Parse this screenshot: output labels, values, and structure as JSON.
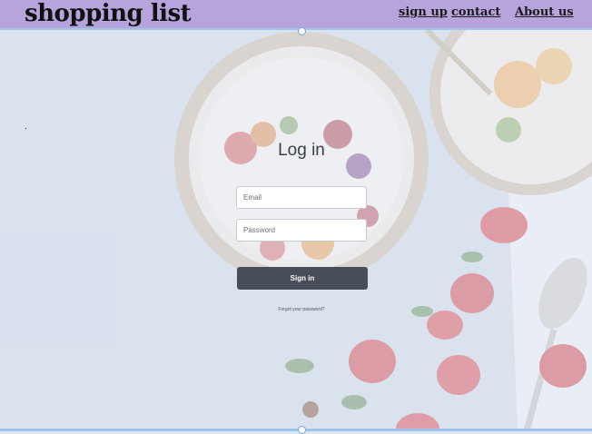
{
  "header": {
    "brand": "shopping list",
    "nav": [
      {
        "label": "sign up"
      },
      {
        "label": "contact"
      },
      {
        "label": "About us"
      }
    ]
  },
  "login": {
    "title": "Log in",
    "email_placeholder": "Email",
    "password_placeholder": "Password",
    "submit_label": "Sign in",
    "forgot_label": "Forgot your password?"
  },
  "colors": {
    "header_bg": "#b8a4dc",
    "button_bg": "#484e57",
    "selection_outline": "#9fc4ea"
  }
}
